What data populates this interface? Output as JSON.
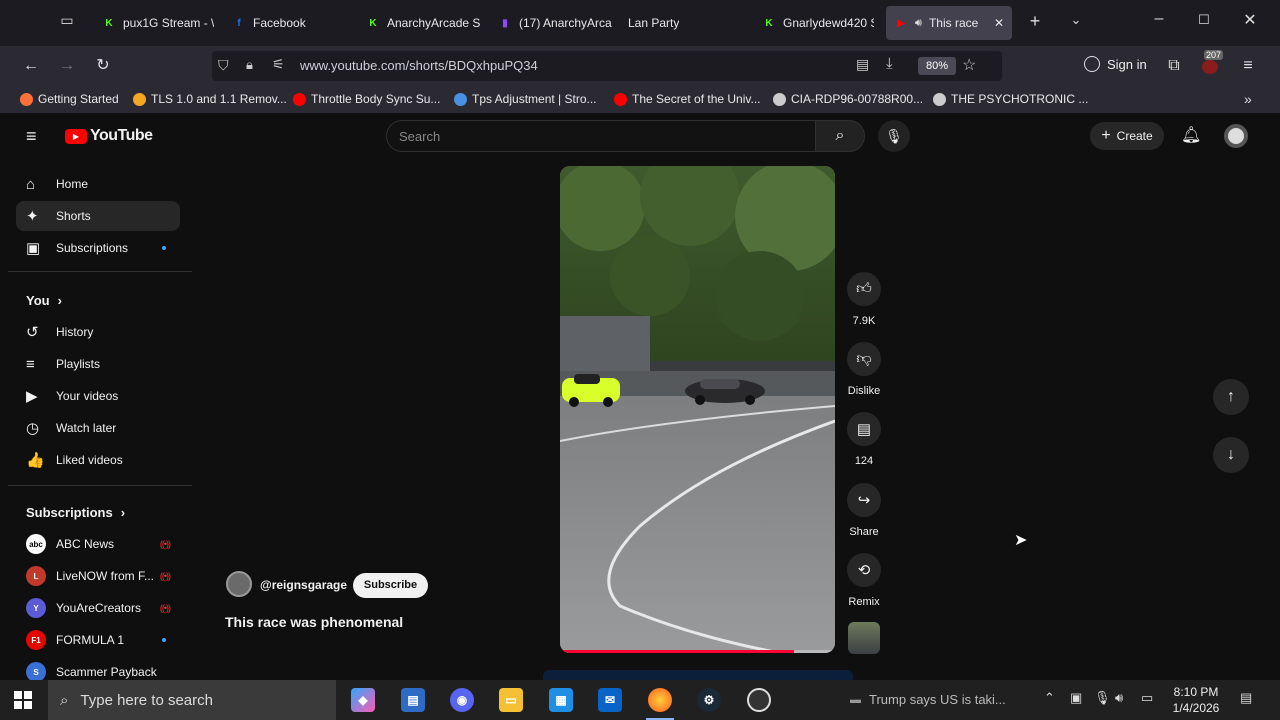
{
  "browser": {
    "tabs": [
      {
        "label": "pux1G Stream - \\",
        "favicon": "kick-icon",
        "color": "#53fc18",
        "glyph": "K"
      },
      {
        "label": "Facebook",
        "favicon": "facebook-icon",
        "color": "#1877f2",
        "glyph": "f"
      },
      {
        "label": "AnarchyArcade S",
        "favicon": "kick-icon",
        "color": "#53fc18",
        "glyph": "K"
      },
      {
        "label": "(17) AnarchyArca",
        "favicon": "twitch-icon",
        "color": "#9146ff",
        "glyph": "▮"
      },
      {
        "label": "Lan Party",
        "favicon": "",
        "color": "",
        "glyph": ""
      },
      {
        "label": "Gnarlydewd420 S",
        "favicon": "kick-icon",
        "color": "#53fc18",
        "glyph": "K"
      },
      {
        "label": "This race",
        "favicon": "youtube-icon",
        "color": "#ff0000",
        "glyph": "▶"
      }
    ],
    "url": "www.youtube.com/shorts/BDQxhpuPQ34",
    "zoom": "80%",
    "sign_in": "Sign in",
    "extension_badge": "207",
    "bookmarks": [
      {
        "label": "Getting Started",
        "icon": "firefox-icon",
        "color": "#ff7139"
      },
      {
        "label": "TLS 1.0 and 1.1 Remov...",
        "icon": "star-icon",
        "color": "#f5a623"
      },
      {
        "label": "Throttle Body Sync Su...",
        "icon": "youtube-icon",
        "color": "#ff0000"
      },
      {
        "label": "Tps Adjustment | Stro...",
        "icon": "s-icon",
        "color": "#4a90e2"
      },
      {
        "label": "The Secret of the Univ...",
        "icon": "youtube-icon",
        "color": "#ff0000"
      },
      {
        "label": "CIA-RDP96-00788R00...",
        "icon": "globe-icon",
        "color": "#cccccc"
      },
      {
        "label": "THE PSYCHOTRONIC ...",
        "icon": "globe-icon",
        "color": "#cccccc"
      }
    ]
  },
  "youtube": {
    "logo_text": "YouTube",
    "search_placeholder": "Search",
    "create_label": "Create",
    "sidebar": {
      "main": [
        {
          "label": "Home",
          "icon": "home-icon",
          "glyph": "⌂"
        },
        {
          "label": "Shorts",
          "icon": "shorts-icon",
          "glyph": "✦"
        },
        {
          "label": "Subscriptions",
          "icon": "subscriptions-icon",
          "glyph": "▣"
        }
      ],
      "you_heading": "You",
      "you": [
        {
          "label": "History",
          "icon": "history-icon",
          "glyph": "↺"
        },
        {
          "label": "Playlists",
          "icon": "playlists-icon",
          "glyph": "≡"
        },
        {
          "label": "Your videos",
          "icon": "your-videos-icon",
          "glyph": "▶"
        },
        {
          "label": "Watch later",
          "icon": "watch-later-icon",
          "glyph": "◷"
        },
        {
          "label": "Liked videos",
          "icon": "liked-videos-icon",
          "glyph": "👍"
        }
      ],
      "subs_heading": "Subscriptions",
      "subscriptions": [
        {
          "label": "ABC News",
          "color": "#ffffff",
          "glyph": "abc",
          "status": "live"
        },
        {
          "label": "LiveNOW from F...",
          "color": "#c0392b",
          "glyph": "L",
          "status": "live"
        },
        {
          "label": "YouAreCreators",
          "color": "#5b5bd6",
          "glyph": "Y",
          "status": "live"
        },
        {
          "label": "FORMULA 1",
          "color": "#e10600",
          "glyph": "F1",
          "status": "new"
        },
        {
          "label": "Scammer Payback",
          "color": "#3a6fd8",
          "glyph": "S",
          "status": ""
        }
      ]
    },
    "short": {
      "channel": "@reignsgarage",
      "subscribe_label": "Subscribe",
      "title": "This race was phenomenal",
      "progress_percent": 85,
      "actions": {
        "likes": "7.9K",
        "dislike": "Dislike",
        "comments": "124",
        "share": "Share",
        "remix": "Remix"
      }
    }
  },
  "taskbar": {
    "search_placeholder": "Type here to search",
    "news_ticker": "Trump says US is taki...",
    "time": "8:10 PM",
    "date": "1/4/2026"
  }
}
